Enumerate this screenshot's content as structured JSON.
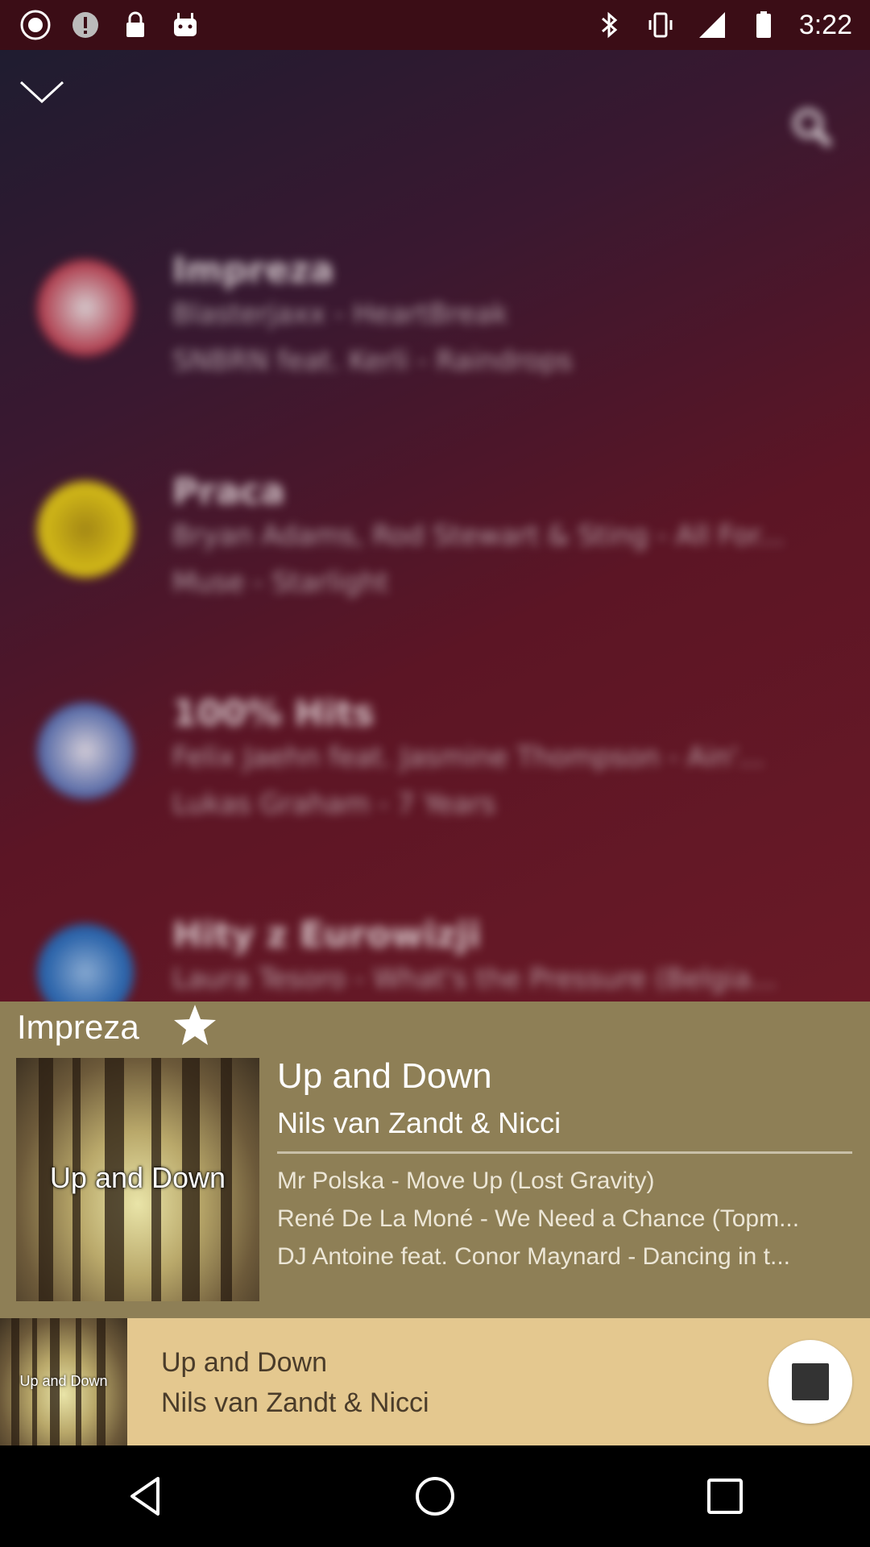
{
  "status_bar": {
    "time": "3:22",
    "left_icons": [
      "app-icon",
      "info-icon",
      "lock-icon",
      "android-icon"
    ],
    "right_icons": [
      "bluetooth-icon",
      "vibrate-icon",
      "signal-icon",
      "battery-icon"
    ]
  },
  "background_list": {
    "items": [
      {
        "title": "Impreza",
        "line1": "Blasterjaxx - HeartBreak",
        "line2": "SNBRN feat. Kerli - Raindrops",
        "avatar_color": "#c23a4a"
      },
      {
        "title": "Praca",
        "line1": "Bryan Adams, Rod Stewart & Sting - All For...",
        "line2": "Muse - Starlight",
        "avatar_color": "#e6cf14"
      },
      {
        "title": "100% Hits",
        "line1": "Felix Jaehn feat. Jasmine Thompson - Ain'...",
        "line2": "Lukas Graham - 7 Years",
        "avatar_color": "#4b6fb8"
      },
      {
        "title": "Hity z Eurowizji",
        "line1": "Laura Tesoro - What's the Pressure (Belgia...",
        "line2": "",
        "avatar_color": "#1f6fc0"
      }
    ]
  },
  "panel": {
    "playlist_title": "Impreza",
    "cover_label": "Up and Down",
    "now_playing_title": "Up and Down",
    "now_playing_artist": "Nils van Zandt & Nicci",
    "queue": [
      "Mr Polska - Move Up (Lost Gravity)",
      "René De La Moné - We Need a Chance (Topm...",
      "DJ Antoine feat. Conor Maynard - Dancing in t..."
    ],
    "bg_color": "#8e7f56"
  },
  "mini_player": {
    "cover_label": "Up and Down",
    "title": "Up and Down",
    "artist": "Nils van Zandt & Nicci",
    "bg_color": "#e4c88f"
  },
  "nav_bar": {
    "buttons": [
      "back-icon",
      "home-icon",
      "recents-icon"
    ]
  }
}
